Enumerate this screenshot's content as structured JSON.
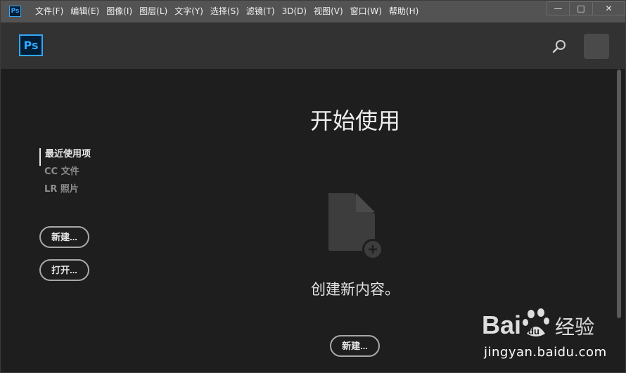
{
  "app": {
    "icon_label": "Ps"
  },
  "menubar": {
    "items": [
      "文件(F)",
      "编辑(E)",
      "图像(I)",
      "图层(L)",
      "文字(Y)",
      "选择(S)",
      "滤镜(T)",
      "3D(D)",
      "视图(V)",
      "窗口(W)",
      "帮助(H)"
    ]
  },
  "window_controls": {
    "minimize": "—",
    "maximize": "□",
    "close": "✕"
  },
  "header": {
    "logo": "Ps",
    "search_icon": "search-icon",
    "avatar": "user-avatar"
  },
  "nav": {
    "items": [
      {
        "label": "最近使用项",
        "active": true
      },
      {
        "label": "CC 文件",
        "active": false
      },
      {
        "label": "LR 照片",
        "active": false
      }
    ],
    "new_button": "新建...",
    "open_button": "打开..."
  },
  "main": {
    "title": "开始使用",
    "icon": "new-document-icon",
    "subtitle": "创建新内容。",
    "new_button": "新建..."
  },
  "watermark": {
    "brand": "Bai du 经验",
    "url": "jingyan.baidu.com"
  },
  "colors": {
    "menubar": "#535353",
    "header": "#323232",
    "body": "#1e1e1e",
    "accent": "#31a8ff",
    "icon": "#3d3d3d"
  }
}
